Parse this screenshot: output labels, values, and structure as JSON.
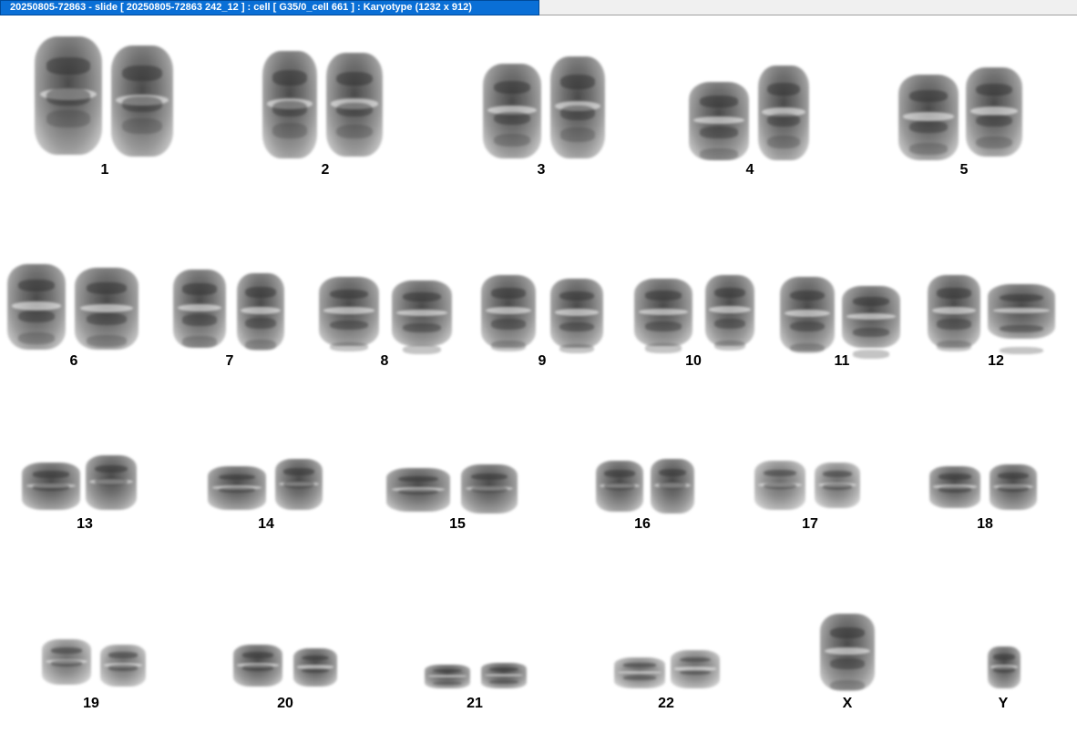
{
  "window": {
    "title": "20250805-72863 - slide [ 20250805-72863 242_12 ] : cell [ G35/0_cell 661 ] : Karyotype  (1232 x 912)"
  },
  "karyotype": {
    "labels": {
      "c1": "1",
      "c2": "2",
      "c3": "3",
      "c4": "4",
      "c5": "5",
      "c6": "6",
      "c7": "7",
      "c8": "8",
      "c9": "9",
      "c10": "10",
      "c11": "11",
      "c12": "12",
      "c13": "13",
      "c14": "14",
      "c15": "15",
      "c16": "16",
      "c17": "17",
      "c18": "18",
      "c19": "19",
      "c20": "20",
      "c21": "21",
      "c22": "22",
      "cx": "X",
      "cy": "Y"
    }
  },
  "colors": {
    "title_bar": "#0a6fd6",
    "title_text": "#ffffff",
    "background": "#ffffff",
    "label_text": "#000000"
  }
}
